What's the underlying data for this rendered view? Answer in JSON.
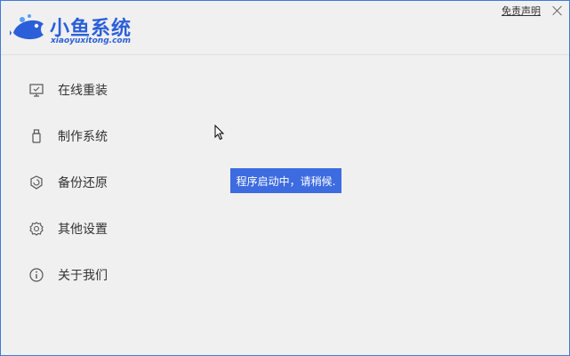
{
  "brand": {
    "name": "小鱼系统",
    "url": "xiaoyuxitong.com"
  },
  "header": {
    "disclaimer_label": "免责声明",
    "close_label": ""
  },
  "sidebar": {
    "items": [
      {
        "label": "在线重装",
        "icon": "monitor-icon"
      },
      {
        "label": "制作系统",
        "icon": "usb-icon"
      },
      {
        "label": "备份还原",
        "icon": "backup-icon"
      },
      {
        "label": "其他设置",
        "icon": "gear-icon"
      },
      {
        "label": "关于我们",
        "icon": "info-icon"
      }
    ]
  },
  "toast": {
    "message": "程序启动中，请稍候."
  },
  "colors": {
    "brand": "#2b5fd9",
    "toast_bg": "#3d6be0",
    "window_border": "#3c7cd6"
  }
}
